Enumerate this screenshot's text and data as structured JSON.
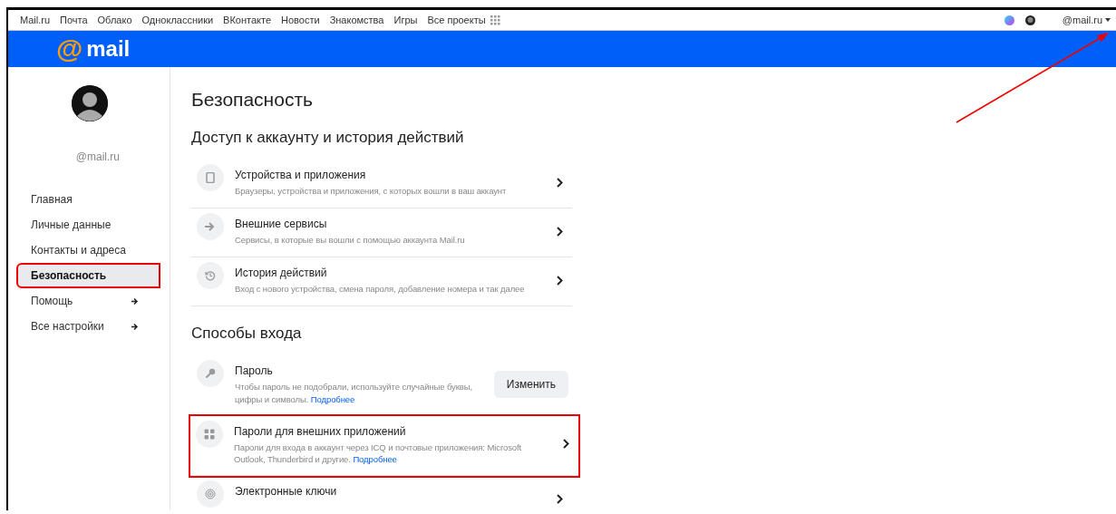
{
  "top_nav": {
    "links": [
      "Mail.ru",
      "Почта",
      "Облако",
      "Одноклассники",
      "ВКонтакте",
      "Новости",
      "Знакомства",
      "Игры",
      "Все проекты"
    ],
    "account": "@mail.ru"
  },
  "logo": {
    "symbol": "@",
    "text": "mail"
  },
  "sidebar": {
    "username": "@mail.ru",
    "items": [
      {
        "label": "Главная",
        "selected": false,
        "arrow": false,
        "highlighted": false
      },
      {
        "label": "Личные данные",
        "selected": false,
        "arrow": false,
        "highlighted": false
      },
      {
        "label": "Контакты и адреса",
        "selected": false,
        "arrow": false,
        "highlighted": false
      },
      {
        "label": "Безопасность",
        "selected": true,
        "arrow": false,
        "highlighted": true
      },
      {
        "label": "Помощь",
        "selected": false,
        "arrow": true,
        "highlighted": false
      },
      {
        "label": "Все настройки",
        "selected": false,
        "arrow": true,
        "highlighted": false
      }
    ]
  },
  "page_title": "Безопасность",
  "sections": [
    {
      "title": "Доступ к аккаунту и история действий",
      "items": [
        {
          "kind": "chevron",
          "title": "Устройства и приложения",
          "description": "Браузеры, устройства и приложения, с которых вошли в ваш аккаунт",
          "highlighted": false
        },
        {
          "kind": "chevron",
          "title": "Внешние сервисы",
          "description": "Сервисы, в которые вы вошли с помощью аккаунта Mail.ru",
          "highlighted": false
        },
        {
          "kind": "chevron",
          "title": "История действий",
          "description": "Вход с нового устройства, смена пароля, добавление номера и так далее",
          "highlighted": false
        }
      ]
    },
    {
      "title": "Способы входа",
      "items": [
        {
          "kind": "button",
          "title": "Пароль",
          "description": "Чтобы пароль не подобрали, используйте случайные буквы, цифры и символы.",
          "link": "Подробнее",
          "button": "Изменить",
          "highlighted": false
        },
        {
          "kind": "chevron",
          "title": "Пароли для внешних приложений",
          "description": "Пароли для входа в аккаунт через ICQ и почтовые приложения: Microsoft Outlook, Thunderbird и другие.",
          "link": "Подробнее",
          "highlighted": true
        },
        {
          "kind": "chevron",
          "title": "Электронные ключи",
          "highlighted": false
        }
      ]
    }
  ],
  "annotation_arrow": true
}
